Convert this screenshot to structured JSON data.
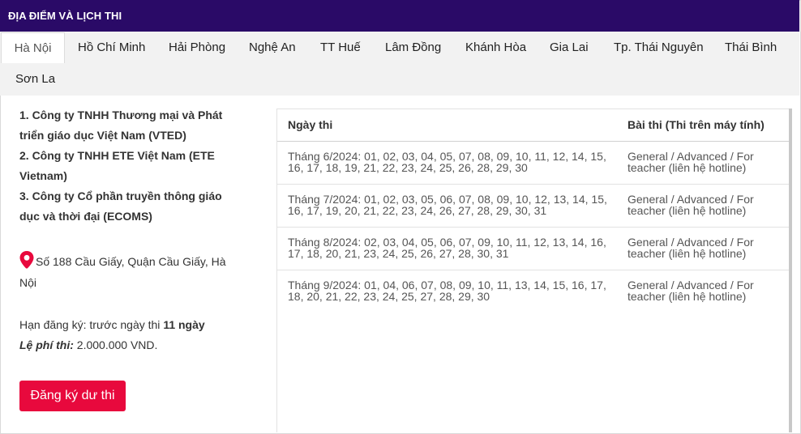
{
  "header": {
    "title": "ĐỊA ĐIỂM VÀ LỊCH THI"
  },
  "tabs": [
    {
      "label": "Hà Nội",
      "active": true
    },
    {
      "label": "Hồ Chí Minh"
    },
    {
      "label": "Hải Phòng"
    },
    {
      "label": "Nghệ An"
    },
    {
      "label": "TT Huế"
    },
    {
      "label": "Lâm Đồng"
    },
    {
      "label": "Khánh Hòa"
    },
    {
      "label": "Gia Lai"
    },
    {
      "label": "Tp. Thái Nguyên"
    },
    {
      "label": "Thái Bình"
    },
    {
      "label": "Sơn La"
    }
  ],
  "venue": {
    "companies": [
      {
        "line1": "1. Công ty TNHH Thương mại và Phát",
        "line2": "triển giáo dục Việt Nam (VTED)"
      },
      {
        "line1": "2. Công ty TNHH ETE Việt Nam (ETE",
        "line2": "Vietnam)"
      },
      {
        "line1": "3. Công ty Cổ phần truyền thông giáo",
        "line2": "dục và thời đại (ECOMS)"
      }
    ],
    "address_line1": "Số 188 Cầu Giấy, Quận Cầu Giấy, Hà",
    "address_line2": "Nội",
    "icon": "map-pin-icon",
    "icon_color": "#e8093d"
  },
  "registration": {
    "deadline_label": "Hạn đăng ký: trước ngày thi ",
    "deadline_value": "11 ngày",
    "fee_label": "Lệ phí thi:",
    "fee_value": " 2.000.000 VND."
  },
  "cta": {
    "label": "Đăng ký dư thi",
    "color": "#e8093d"
  },
  "schedule": {
    "columns": [
      "Ngày thi",
      "Bài thi (Thi trên máy tính)"
    ],
    "rows": [
      {
        "date_line1": "Tháng 6/2024: 01, 02, 03, 04, 05, 07, 08, 09, 10, 11, 12, 14, 15,",
        "date_line2": "16, 17, 18, 19, 21, 22, 23, 24, 25, 26, 28, 29, 30",
        "exam_line1": "General / Advanced / For",
        "exam_line2": "teacher (liên hệ hotline)"
      },
      {
        "date_line1": "Tháng 7/2024: 01, 02, 03, 05, 06, 07, 08, 09, 10, 12, 13, 14, 15,",
        "date_line2": "16, 17, 19, 20, 21, 22, 23, 24, 26, 27, 28, 29, 30, 31",
        "exam_line1": "General / Advanced / For",
        "exam_line2": "teacher (liên hệ hotline)"
      },
      {
        "date_line1": "Tháng 8/2024: 02, 03, 04, 05, 06, 07, 09, 10, 11, 12, 13, 14, 16,",
        "date_line2": "17, 18, 20, 21, 23, 24, 25, 26, 27, 28, 30, 31",
        "exam_line1": "General / Advanced / For",
        "exam_line2": "teacher (liên hệ hotline)"
      },
      {
        "date_line1": "Tháng 9/2024: 01, 04, 06, 07, 08, 09, 10, 11, 13, 14, 15, 16, 17,",
        "date_line2": "18, 20, 21, 22, 23, 24, 25, 27, 28, 29, 30",
        "exam_line1": "General / Advanced / For",
        "exam_line2": "teacher (liên hệ hotline)"
      }
    ]
  },
  "colors": {
    "header_bg": "#2a0a67",
    "tab_bar_bg": "#f2f2f2",
    "button_bg": "#e8093d"
  }
}
